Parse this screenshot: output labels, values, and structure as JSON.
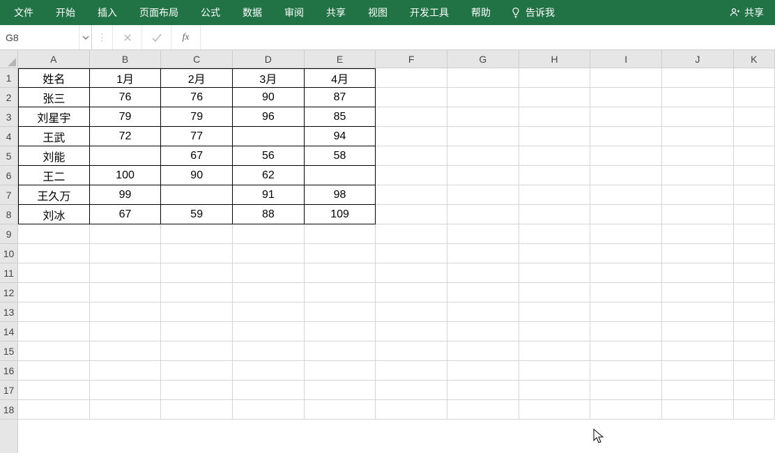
{
  "ribbon": {
    "tabs": [
      "文件",
      "开始",
      "插入",
      "页面布局",
      "公式",
      "数据",
      "审阅",
      "共享",
      "视图",
      "开发工具",
      "帮助"
    ],
    "tell_me": "告诉我",
    "share": "共享"
  },
  "nameBox": {
    "value": "G8"
  },
  "formulaBar": {
    "value": "",
    "fx": "fx"
  },
  "columns": [
    {
      "label": "A",
      "width": 104
    },
    {
      "label": "B",
      "width": 104
    },
    {
      "label": "C",
      "width": 104
    },
    {
      "label": "D",
      "width": 104
    },
    {
      "label": "E",
      "width": 104
    },
    {
      "label": "F",
      "width": 104
    },
    {
      "label": "G",
      "width": 104
    },
    {
      "label": "H",
      "width": 104
    },
    {
      "label": "I",
      "width": 104
    },
    {
      "label": "J",
      "width": 104
    },
    {
      "label": "K",
      "width": 60
    }
  ],
  "rowCount": 18,
  "dataRegion": {
    "rows": 8,
    "cols": 5
  },
  "table": [
    [
      "姓名",
      "1月",
      "2月",
      "3月",
      "4月"
    ],
    [
      "张三",
      "76",
      "76",
      "90",
      "87"
    ],
    [
      "刘星宇",
      "79",
      "79",
      "96",
      "85"
    ],
    [
      "王武",
      "72",
      "77",
      "",
      "94"
    ],
    [
      "刘能",
      "",
      "67",
      "56",
      "58"
    ],
    [
      "王二",
      "100",
      "90",
      "62",
      ""
    ],
    [
      "王久万",
      "99",
      "",
      "91",
      "98"
    ],
    [
      "刘冰",
      "67",
      "59",
      "88",
      "109"
    ]
  ]
}
